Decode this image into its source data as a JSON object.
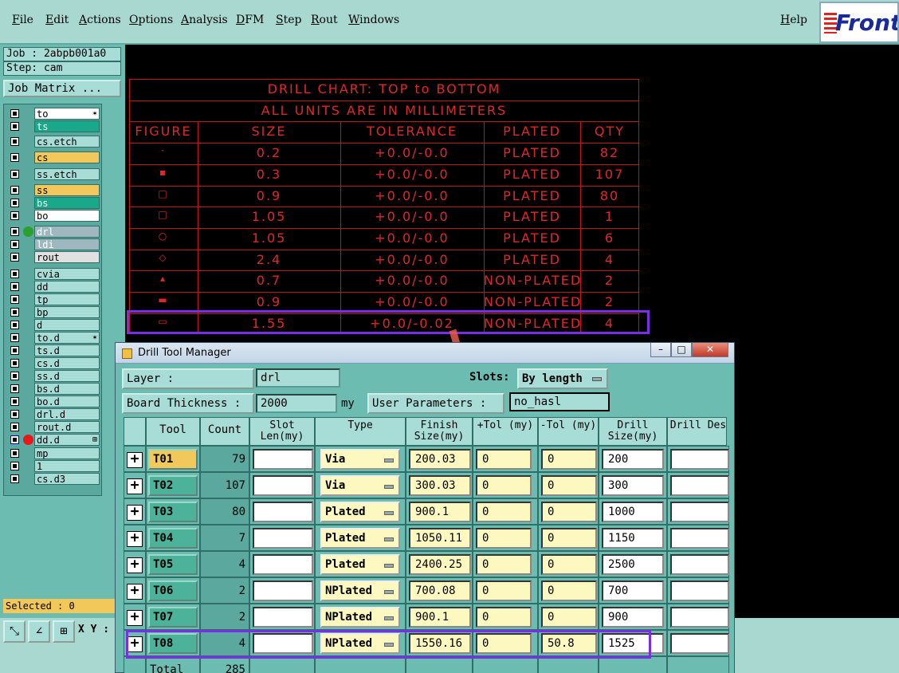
{
  "menu": [
    "File",
    "Edit",
    "Actions",
    "Options",
    "Analysis",
    "DFM",
    "Step",
    "Rout",
    "Windows"
  ],
  "help": "Help",
  "logo_text": "Front",
  "job_label": "Job : 2abpb001a0",
  "step_label": "Step: cam",
  "job_matrix_btn": "Job Matrix ...",
  "layers": [
    {
      "name": "to",
      "color": "#ffffff",
      "mark": "✶"
    },
    {
      "name": "ts",
      "color": "#1aa88a",
      "mark": ""
    },
    {
      "name": "cs.etch",
      "color": "#a8dcd6",
      "mark": ""
    },
    {
      "name": "cs",
      "color": "#f2c85a",
      "mark": ""
    },
    {
      "name": "ss.etch",
      "color": "#a8dcd6",
      "mark": ""
    },
    {
      "name": "ss",
      "color": "#f2c85a",
      "mark": ""
    },
    {
      "name": "bs",
      "color": "#1aa88a",
      "mark": ""
    },
    {
      "name": "bo",
      "color": "#ffffff",
      "mark": ""
    },
    {
      "name": "drl",
      "color": "#9fb8c0",
      "mark": ""
    },
    {
      "name": "ldi",
      "color": "#9fb8c0",
      "mark": ""
    },
    {
      "name": "rout",
      "color": "#e0e0e0",
      "mark": ""
    },
    {
      "name": "cvia",
      "color": "#a8dcd6",
      "mark": ""
    },
    {
      "name": "dd",
      "color": "#a8dcd6",
      "mark": ""
    },
    {
      "name": "tp",
      "color": "#a8dcd6",
      "mark": ""
    },
    {
      "name": "bp",
      "color": "#a8dcd6",
      "mark": ""
    },
    {
      "name": "d",
      "color": "#a8dcd6",
      "mark": ""
    },
    {
      "name": "to.d",
      "color": "#a8dcd6",
      "mark": "✶"
    },
    {
      "name": "ts.d",
      "color": "#a8dcd6",
      "mark": ""
    },
    {
      "name": "cs.d",
      "color": "#a8dcd6",
      "mark": ""
    },
    {
      "name": "ss.d",
      "color": "#a8dcd6",
      "mark": ""
    },
    {
      "name": "bs.d",
      "color": "#a8dcd6",
      "mark": ""
    },
    {
      "name": "bo.d",
      "color": "#a8dcd6",
      "mark": ""
    },
    {
      "name": "drl.d",
      "color": "#a8dcd6",
      "mark": ""
    },
    {
      "name": "rout.d",
      "color": "#a8dcd6",
      "mark": ""
    },
    {
      "name": "dd.d",
      "color": "#a8dcd6",
      "mark": "⊞"
    },
    {
      "name": "mp",
      "color": "#a8dcd6",
      "mark": ""
    },
    {
      "name": "1",
      "color": "#a8dcd6",
      "mark": ""
    },
    {
      "name": "cs.d3",
      "color": "#a8dcd6",
      "mark": ""
    }
  ],
  "selected_label": "Selected : 0",
  "xy_label": "X Y :",
  "chart": {
    "title1": "DRILL CHART: TOP to BOTTOM",
    "title2": "ALL UNITS ARE IN MILLIMETERS",
    "headers": [
      "FIGURE",
      "SIZE",
      "TOLERANCE",
      "PLATED",
      "QTY"
    ],
    "rows": [
      {
        "fig": "·",
        "size": "0.2",
        "tol": "+0.0/-0.0",
        "plated": "PLATED",
        "qty": "82"
      },
      {
        "fig": "▪",
        "size": "0.3",
        "tol": "+0.0/-0.0",
        "plated": "PLATED",
        "qty": "107"
      },
      {
        "fig": "□",
        "size": "0.9",
        "tol": "+0.0/-0.0",
        "plated": "PLATED",
        "qty": "80"
      },
      {
        "fig": "□",
        "size": "1.05",
        "tol": "+0.0/-0.0",
        "plated": "PLATED",
        "qty": "1"
      },
      {
        "fig": "○",
        "size": "1.05",
        "tol": "+0.0/-0.0",
        "plated": "PLATED",
        "qty": "6"
      },
      {
        "fig": "◇",
        "size": "2.4",
        "tol": "+0.0/-0.0",
        "plated": "PLATED",
        "qty": "4"
      },
      {
        "fig": "▴",
        "size": "0.7",
        "tol": "+0.0/-0.0",
        "plated": "NON-PLATED",
        "qty": "2"
      },
      {
        "fig": "▬",
        "size": "0.9",
        "tol": "+0.0/-0.0",
        "plated": "NON-PLATED",
        "qty": "2"
      },
      {
        "fig": "▭",
        "size": "1.55",
        "tol": "+0.0/-0.02",
        "plated": "NON-PLATED",
        "qty": "4"
      }
    ]
  },
  "dialog": {
    "title": "Drill Tool Manager",
    "layer_label": "Layer            :",
    "layer_value": "drl",
    "slots_label": "Slots:",
    "slots_value": "By length",
    "board_thickness_label": "Board Thickness :",
    "board_thickness_value": "2000",
    "board_thickness_unit": "my",
    "user_params_label": "User Parameters :",
    "user_params_value": "no_hasl",
    "columns": [
      "Tool",
      "Count",
      "Slot Len(my)",
      "Type",
      "Finish Size(my)",
      "+Tol (my)",
      "-Tol (my)",
      "Drill Size(my)",
      "Drill Des"
    ],
    "rows": [
      {
        "tool": "T01",
        "count": "79",
        "slot": "",
        "type": "Via",
        "finish": "200.03",
        "ptol": "0",
        "mtol": "0",
        "drill": "200",
        "des": "",
        "active": true
      },
      {
        "tool": "T02",
        "count": "107",
        "slot": "",
        "type": "Via",
        "finish": "300.03",
        "ptol": "0",
        "mtol": "0",
        "drill": "300",
        "des": "",
        "active": false
      },
      {
        "tool": "T03",
        "count": "80",
        "slot": "",
        "type": "Plated",
        "finish": "900.1",
        "ptol": "0",
        "mtol": "0",
        "drill": "1000",
        "des": "",
        "active": false
      },
      {
        "tool": "T04",
        "count": "7",
        "slot": "",
        "type": "Plated",
        "finish": "1050.11",
        "ptol": "0",
        "mtol": "0",
        "drill": "1150",
        "des": "",
        "active": false
      },
      {
        "tool": "T05",
        "count": "4",
        "slot": "",
        "type": "Plated",
        "finish": "2400.25",
        "ptol": "0",
        "mtol": "0",
        "drill": "2500",
        "des": "",
        "active": false
      },
      {
        "tool": "T06",
        "count": "2",
        "slot": "",
        "type": "NPlated",
        "finish": "700.08",
        "ptol": "0",
        "mtol": "0",
        "drill": "700",
        "des": "",
        "active": false
      },
      {
        "tool": "T07",
        "count": "2",
        "slot": "",
        "type": "NPlated",
        "finish": "900.1",
        "ptol": "0",
        "mtol": "0",
        "drill": "900",
        "des": "",
        "active": false
      },
      {
        "tool": "T08",
        "count": "4",
        "slot": "",
        "type": "NPlated",
        "finish": "1550.16",
        "ptol": "0",
        "mtol": "50.8",
        "drill": "1525",
        "des": "",
        "active": false
      }
    ],
    "total_label": "Total",
    "total_count": "285"
  },
  "colors": {
    "accent_highlight": "#7a2ee8",
    "arrow": "#e85a4a",
    "chart_red": "#e02020",
    "panel": "#6dbcb2"
  }
}
